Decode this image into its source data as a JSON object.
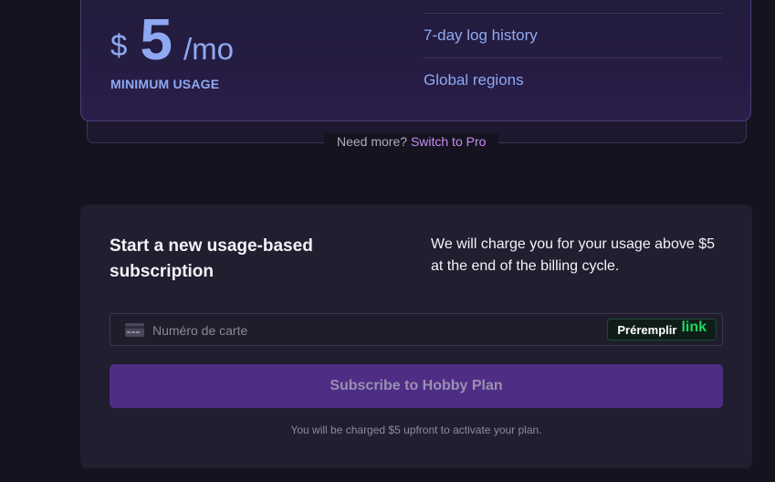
{
  "plan": {
    "currency": "$",
    "amount": "5",
    "period": "/mo",
    "minimum_label": "MINIMUM USAGE",
    "features": [
      "7-day log history",
      "Global regions"
    ]
  },
  "upgrade": {
    "prefix": "Need more?",
    "link_label": "Switch to Pro"
  },
  "subscription": {
    "title": "Start a new usage-based subscription",
    "description": "We will charge you for your usage above $5 at the end of the billing cycle.",
    "card_placeholder": "Numéro de carte",
    "prefill_label": "Préremplir",
    "prefill_brand": "link",
    "subscribe_label": "Subscribe to Hobby Plan",
    "footnote": "You will be charged $5 upfront to activate your plan."
  },
  "colors": {
    "accent": "#8ea9f2",
    "link_purple": "#c68df4",
    "button_bg": "#4e2d84",
    "link_green": "#1ed760"
  },
  "icons": {
    "card": "credit-card-icon"
  }
}
